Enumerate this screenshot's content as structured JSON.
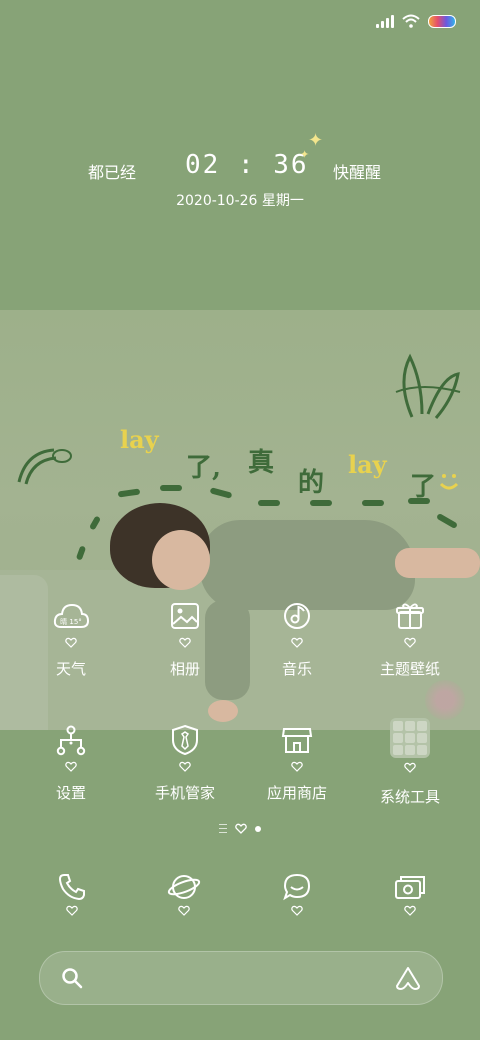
{
  "status_bar": {
    "icons": [
      "signal-icon",
      "wifi-icon",
      "battery-icon"
    ]
  },
  "lockclock": {
    "left_text": "都已经",
    "time": "02 : 36",
    "right_text": "快醒醒",
    "date": "2020-10-26  星期一"
  },
  "wallpaper_text": {
    "w1": "lay",
    "w2": "了,",
    "w3": "真",
    "w4": "的",
    "w5": "lay",
    "w6": "了"
  },
  "apps_row1": [
    {
      "label": "天气",
      "icon": "weather-icon",
      "badge": "晴 15°"
    },
    {
      "label": "相册",
      "icon": "gallery-icon"
    },
    {
      "label": "音乐",
      "icon": "music-icon"
    },
    {
      "label": "主题壁纸",
      "icon": "theme-icon"
    }
  ],
  "apps_row2": [
    {
      "label": "设置",
      "icon": "settings-icon"
    },
    {
      "label": "手机管家",
      "icon": "security-icon"
    },
    {
      "label": "应用商店",
      "icon": "store-icon"
    },
    {
      "label": "系统工具",
      "icon": "tools-folder-icon"
    }
  ],
  "dock": [
    {
      "icon": "phone-icon"
    },
    {
      "icon": "browser-icon"
    },
    {
      "icon": "messages-icon"
    },
    {
      "icon": "camera-icon"
    }
  ],
  "pager": {
    "pages": 2,
    "active": 1
  },
  "colors": {
    "background": "#87a377",
    "accent_dark": "#3f6b3a",
    "deco_yellow": "#e8d24e"
  }
}
